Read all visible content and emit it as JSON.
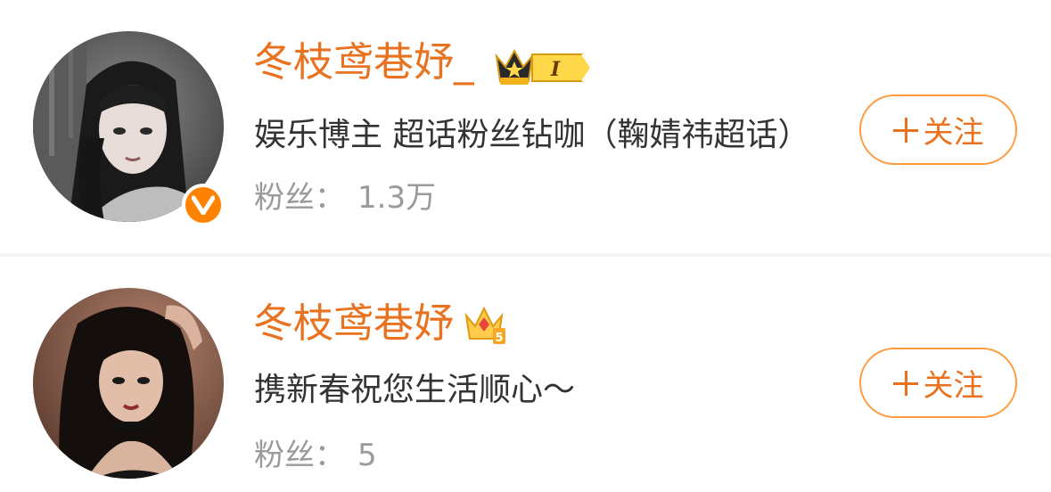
{
  "users": [
    {
      "username": "冬枝鸢巷妤_",
      "level_badge": "I",
      "bio": "娱乐博主 超话粉丝钻咖（鞠婧祎超话）",
      "fans_label": "粉丝：",
      "fans_count": "1.3万",
      "follow_label": "关注",
      "verified_mark": "V"
    },
    {
      "username": "冬枝鸢巷妤",
      "level_badge": "5",
      "bio": "携新春祝您生活顺心～",
      "fans_label": "粉丝：",
      "fans_count": "5",
      "follow_label": "关注"
    }
  ],
  "colors": {
    "accent": "#e8721f",
    "button_border": "#ff9a3d",
    "verified": "#ff8200",
    "bio_text": "#333333",
    "muted_text": "#9a9a9a"
  },
  "icons": {
    "plus": "plus-icon",
    "crown": "crown-icon",
    "verified": "verified-icon"
  }
}
